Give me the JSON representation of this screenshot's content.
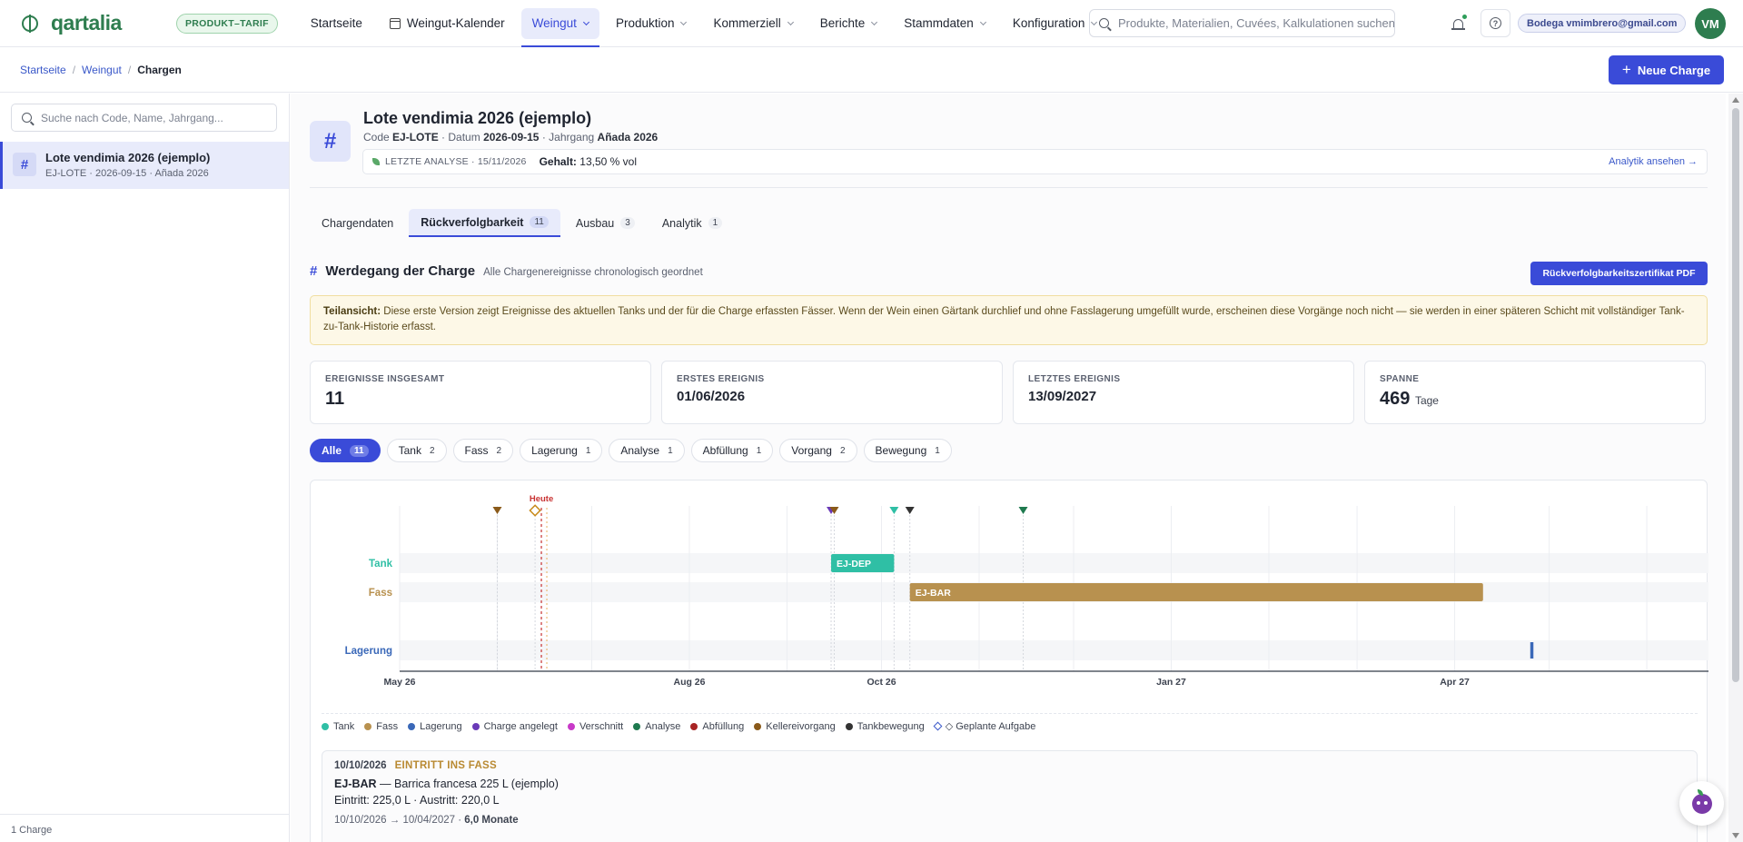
{
  "app": {
    "logo": "qartalia",
    "plan_badge": "PRODUKT–TARIF",
    "nav": [
      {
        "label": "Startseite"
      },
      {
        "label": "Weingut-Kalender"
      },
      {
        "label": "Weingut"
      },
      {
        "label": "Produktion"
      },
      {
        "label": "Kommerziell"
      },
      {
        "label": "Berichte"
      },
      {
        "label": "Stammdaten"
      },
      {
        "label": "Konfiguration"
      }
    ],
    "search_placeholder": "Produkte, Materialien, Cuvées, Kalkulationen suchen",
    "help_icon": "?",
    "user_label": "Bodega vmimbrero@gmail.com",
    "avatar_initials": "VM"
  },
  "breadcrumb": {
    "items": [
      "Startseite",
      "Weingut",
      "Chargen"
    ],
    "separator": "/"
  },
  "new_button": {
    "icon": "+",
    "label": "Neue Charge"
  },
  "sidebar": {
    "search_placeholder": "Suche nach Code, Name, Jahrgang...",
    "items": [
      {
        "icon": "#",
        "title": "Lote vendimia 2026 (ejemplo)",
        "subtitle": "EJ-LOTE · 2026-09-15 · Añada 2026"
      }
    ],
    "footer": "1 Charge"
  },
  "batch": {
    "icon": "#",
    "title": "Lote vendimia 2026 (ejemplo)",
    "meta": {
      "code_label": "Code",
      "code": "EJ-LOTE",
      "date_label": "· Datum",
      "date": "2026-09-15",
      "vintage_label": "· Jahrgang",
      "vintage": "Añada 2026"
    },
    "analysis": {
      "label": "LETZTE ANALYSE · 15/11/2026",
      "content_label": "Gehalt:",
      "content_value": "13,50 % vol",
      "link": "Analytik ansehen →"
    }
  },
  "tabs": [
    {
      "label": "Chargendaten",
      "count": ""
    },
    {
      "label": "Rückverfolgbarkeit",
      "count": "11"
    },
    {
      "label": "Ausbau",
      "count": "3"
    },
    {
      "label": "Analytik",
      "count": "1"
    }
  ],
  "section": {
    "icon": "#",
    "title": "Werdegang der Charge",
    "subtitle": "Alle Chargenereignisse chronologisch geordnet",
    "pdf_button": "Rückverfolgbarkeitszertifikat PDF"
  },
  "warning": {
    "lead": "Teilansicht:",
    "text": "Diese erste Version zeigt Ereignisse des aktuellen Tanks und der für die Charge erfassten Fässer. Wenn der Wein einen Gärtank durchlief und ohne Fasslagerung umgefüllt wurde, erscheinen diese Vorgänge noch nicht — sie werden in einer späteren Schicht mit vollständiger Tank-zu-Tank-Historie erfasst."
  },
  "stats": [
    {
      "label": "EREIGNISSE INSGESAMT",
      "value": "11",
      "unit": ""
    },
    {
      "label": "ERSTES EREIGNIS",
      "value": "01/06/2026",
      "unit": ""
    },
    {
      "label": "LETZTES EREIGNIS",
      "value": "13/09/2027",
      "unit": ""
    },
    {
      "label": "SPANNE",
      "value": "469",
      "unit": "Tage"
    }
  ],
  "filters": [
    {
      "label": "Alle",
      "count": "11"
    },
    {
      "label": "Tank",
      "count": "2"
    },
    {
      "label": "Fass",
      "count": "2"
    },
    {
      "label": "Lagerung",
      "count": "1"
    },
    {
      "label": "Analyse",
      "count": "1"
    },
    {
      "label": "Abfüllung",
      "count": "1"
    },
    {
      "label": "Vorgang",
      "count": "2"
    },
    {
      "label": "Bewegung",
      "count": "1"
    }
  ],
  "colors": {
    "accent": "#3a4bd8",
    "tank": "#2fbfa5",
    "fass": "#b8914f",
    "lagerung": "#3a68b8",
    "charge_angelegt": "#6a3ab8",
    "verschnitt": "#c83ac8",
    "analyse": "#1f7a4f",
    "abfuellung": "#a82424",
    "kellereivorgang": "#8a5a1a",
    "tankbewegung": "#333333",
    "geplant": "#3a58c9",
    "heute": "#c83232"
  },
  "chart_data": {
    "type": "timeline",
    "today_label": "Heute",
    "today": "2026-06-15",
    "x_ticks": [
      {
        "date": "2026-05-01",
        "label": "May 26"
      },
      {
        "date": "2026-08-01",
        "label": "Aug 26"
      },
      {
        "date": "2026-10-01",
        "label": "Oct 26"
      },
      {
        "date": "2027-01-01",
        "label": "Jan 27"
      },
      {
        "date": "2027-04-01",
        "label": "Apr 27"
      }
    ],
    "lanes": [
      {
        "key": "tank",
        "label": "Tank",
        "color": "#2fbfa5"
      },
      {
        "key": "fass",
        "label": "Fass",
        "color": "#b8914f"
      },
      {
        "key": "blank",
        "label": "",
        "color": ""
      },
      {
        "key": "lagerung",
        "label": "Lagerung",
        "color": "#3a68b8"
      }
    ],
    "bars": [
      {
        "lane": "tank",
        "label": "EJ-DEP",
        "start": "2026-09-15",
        "end": "2026-10-05",
        "color": "#2fbfa5"
      },
      {
        "lane": "fass",
        "label": "EJ-BAR",
        "start": "2026-10-10",
        "end": "2027-04-10",
        "color": "#b8914f"
      },
      {
        "lane": "lagerung",
        "label": "",
        "start": "2027-04-25",
        "end": "2027-04-26",
        "color": "#3a68b8"
      }
    ],
    "markers": [
      {
        "date": "2026-06-01",
        "color": "#8a5a1a",
        "kind": "triangle"
      },
      {
        "date": "2026-06-13",
        "color": "#c88a1a",
        "kind": "diamond"
      },
      {
        "date": "2026-09-15",
        "color": "#6a3ab8",
        "kind": "triangle"
      },
      {
        "date": "2026-09-16",
        "color": "#8a5a1a",
        "kind": "triangle"
      },
      {
        "date": "2026-10-05",
        "color": "#2fbfa5",
        "kind": "triangle"
      },
      {
        "date": "2026-10-10",
        "color": "#333333",
        "kind": "triangle"
      },
      {
        "date": "2026-11-15",
        "color": "#1f7a4f",
        "kind": "triangle"
      }
    ],
    "legend": [
      {
        "label": "Tank",
        "color": "#2fbfa5",
        "shape": "dot"
      },
      {
        "label": "Fass",
        "color": "#b8914f",
        "shape": "dot"
      },
      {
        "label": "Lagerung",
        "color": "#3a68b8",
        "shape": "dot"
      },
      {
        "label": "Charge angelegt",
        "color": "#6a3ab8",
        "shape": "dot"
      },
      {
        "label": "Verschnitt",
        "color": "#c83ac8",
        "shape": "dot"
      },
      {
        "label": "Analyse",
        "color": "#1f7a4f",
        "shape": "dot"
      },
      {
        "label": "Abfüllung",
        "color": "#a82424",
        "shape": "dot"
      },
      {
        "label": "Kellereivorgang",
        "color": "#8a5a1a",
        "shape": "dot"
      },
      {
        "label": "Tankbewegung",
        "color": "#333333",
        "shape": "dot"
      },
      {
        "label": "◇ Geplante Aufgabe",
        "color": "#3a58c9",
        "shape": "diamond"
      }
    ]
  },
  "event": {
    "date": "10/10/2026",
    "type": "EINTRITT INS FASS",
    "code": "EJ-BAR",
    "desc": "— Barrica francesa 225 L (ejemplo)",
    "volumes": "Eintritt: 225,0 L · Austritt: 220,0 L",
    "range": "10/10/2026 → 10/04/2027 ·",
    "duration": "6,0 Monate"
  }
}
